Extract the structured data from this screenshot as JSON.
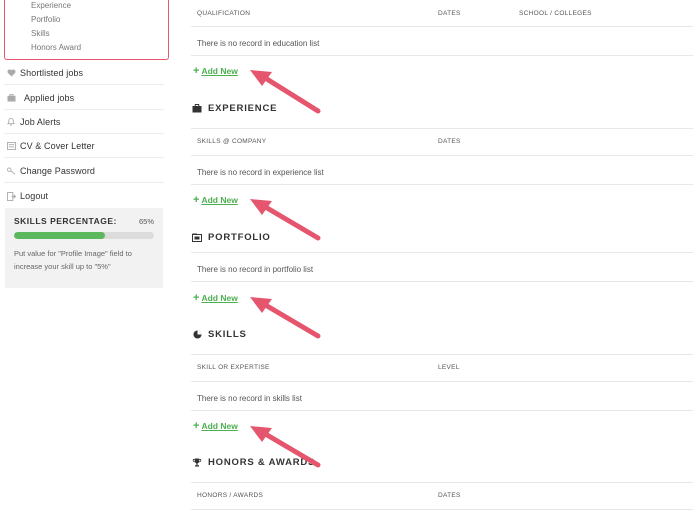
{
  "sidebar": {
    "submenu": [
      "Experience",
      "Portfolio",
      "Skills",
      "Honors Award"
    ],
    "items": [
      {
        "icon": "heart-icon",
        "label": "Shortlisted jobs"
      },
      {
        "icon": "briefcase-icon",
        "label": "Applied jobs"
      },
      {
        "icon": "bell-icon",
        "label": "Job Alerts"
      },
      {
        "icon": "document-icon",
        "label": "CV & Cover Letter"
      },
      {
        "icon": "key-icon",
        "label": "Change Password"
      },
      {
        "icon": "logout-icon",
        "label": "Logout"
      }
    ],
    "skills": {
      "title": "SKILLS PERCENTAGE:",
      "percent_label": "65%",
      "progress_fraction": 0.65,
      "note": "Put value for \"Profile Image\" field to increase your skill up to \"5%\""
    }
  },
  "main": {
    "education": {
      "columns": [
        "QUALIFICATION",
        "DATES",
        "SCHOOL / COLLEGES"
      ],
      "empty": "There is no record in education list",
      "add_label": "Add New"
    },
    "experience": {
      "title": "EXPERIENCE",
      "columns": [
        "SKILLS @ COMPANY",
        "DATES"
      ],
      "empty": "There is no record in experience list",
      "add_label": "Add New"
    },
    "portfolio": {
      "title": "PORTFOLIO",
      "empty": "There is no record in portfolio list",
      "add_label": "Add New"
    },
    "skills": {
      "title": "SKILLS",
      "columns": [
        "SKILL OR EXPERTISE",
        "LEVEL"
      ],
      "empty": "There is no record in skills list",
      "add_label": "Add New"
    },
    "honors": {
      "title": "HONORS & AWARDS",
      "columns": [
        "HONORS / AWARDS",
        "DATES"
      ]
    }
  },
  "colors": {
    "accent_green": "#4caf50",
    "annotation_red": "#e5566e",
    "progress_green": "#5cb85c"
  }
}
